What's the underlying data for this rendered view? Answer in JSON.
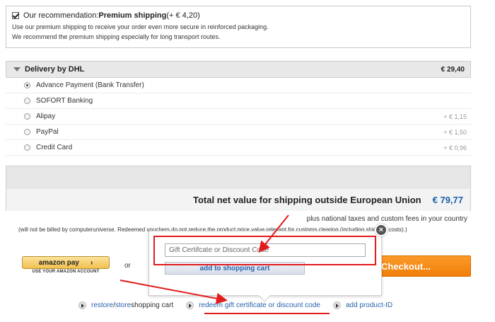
{
  "premium": {
    "label_prefix": "Our recommendation: ",
    "label_strong": "Premium shipping",
    "label_price": " (+ € 4,20)",
    "line1": "Use our premium shipping to receive your order even more secure in reinforced packaging.",
    "line2": "We recommend the premium shipping especially for long transport routes."
  },
  "delivery": {
    "title": "Delivery by DHL",
    "price": "€ 29,40",
    "methods": [
      {
        "label": "Advance Payment (Bank Transfer)",
        "fee": ""
      },
      {
        "label": "SOFORT Banking",
        "fee": ""
      },
      {
        "label": "Alipay",
        "fee": "+ € 1,15"
      },
      {
        "label": "PayPal",
        "fee": "+ € 1,50"
      },
      {
        "label": "Credit Card",
        "fee": "+ € 0,96"
      }
    ]
  },
  "total": {
    "label": "Total net value for shipping outside European Union",
    "price": "€ 79,77"
  },
  "taxes_note": "plus national taxes and custom fees in your country",
  "billing_note": "(will not be billed by computeruniverse. Redeemed vouchers do not reduce the product price value relevant for customs clearing (including shipping costs).)",
  "amazon": {
    "label": "amazon pay",
    "chevron": "›",
    "sub": "USE YOUR AMAZON ACCOUNT"
  },
  "or_text": "or",
  "checkout": {
    "label": "Checkout..."
  },
  "popup": {
    "close": "×",
    "input_placeholder": "Gift Certifcate or Discount Code",
    "add_button": "add to shopping cart"
  },
  "links": {
    "restore": "restore",
    "sep": " / ",
    "store": "store",
    "cart_text": " shopping cart",
    "redeem": "redeem gift certificate or discount code",
    "add_product": "add product-ID"
  },
  "colors": {
    "accent": "#f07f08",
    "link": "#2a64ad",
    "annotation": "#e21b1b"
  }
}
